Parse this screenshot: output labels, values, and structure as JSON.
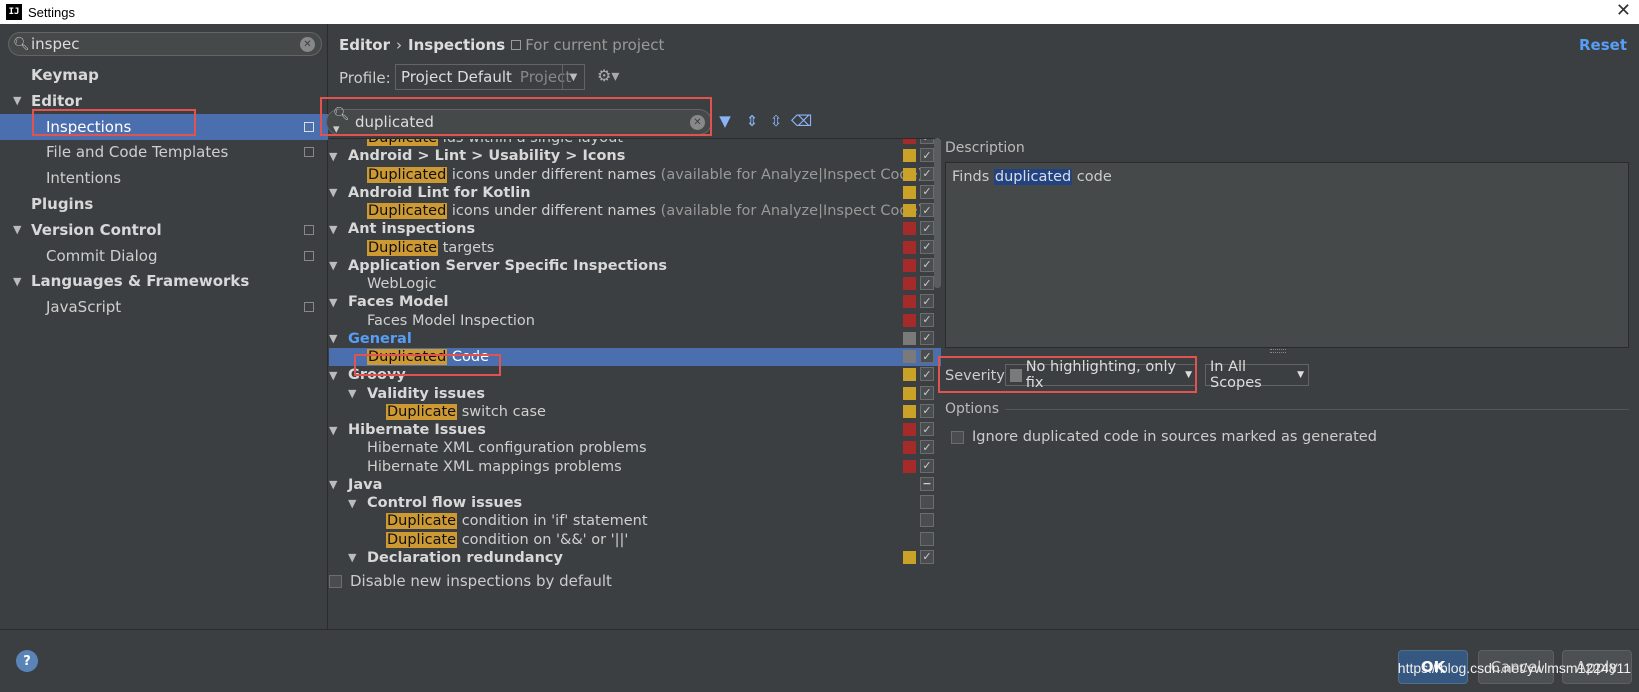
{
  "window": {
    "title": "Settings",
    "app_icon": "IJ"
  },
  "sidebar": {
    "search_value": "inspec",
    "items": [
      {
        "label": "Keymap",
        "bold": true,
        "arrow": "",
        "copy": false,
        "selected": false,
        "indent": 1
      },
      {
        "label": "Editor",
        "bold": true,
        "arrow": "▼",
        "copy": false,
        "selected": false,
        "indent": 1
      },
      {
        "label": "Inspections",
        "bold": false,
        "arrow": "",
        "copy": true,
        "selected": true,
        "indent": 2
      },
      {
        "label": "File and Code Templates",
        "bold": false,
        "arrow": "",
        "copy": true,
        "selected": false,
        "indent": 2
      },
      {
        "label": "Intentions",
        "bold": false,
        "arrow": "",
        "copy": false,
        "selected": false,
        "indent": 2
      },
      {
        "label": "Plugins",
        "bold": true,
        "arrow": "",
        "copy": false,
        "selected": false,
        "indent": 1
      },
      {
        "label": "Version Control",
        "bold": true,
        "arrow": "▼",
        "copy": true,
        "selected": false,
        "indent": 1
      },
      {
        "label": "Commit Dialog",
        "bold": false,
        "arrow": "",
        "copy": true,
        "selected": false,
        "indent": 2
      },
      {
        "label": "Languages & Frameworks",
        "bold": true,
        "arrow": "▼",
        "copy": false,
        "selected": false,
        "indent": 1
      },
      {
        "label": "JavaScript",
        "bold": false,
        "arrow": "",
        "copy": true,
        "selected": false,
        "indent": 2
      }
    ]
  },
  "header": {
    "crumb_1": "Editor",
    "crumb_sep": "›",
    "crumb_2": "Inspections",
    "scope_note": "For current project",
    "reset_label": "Reset"
  },
  "profile": {
    "label": "Profile:",
    "value": "Project Default",
    "type": "Project"
  },
  "inspection_search": {
    "value": "duplicated"
  },
  "colors": {
    "error": "#a52a2a",
    "warning": "#c9a227",
    "none": "#7a7a7a",
    "highlight": "#cc9933",
    "selection": "#4b6eaf",
    "link": "#589df6"
  },
  "inspections": [
    {
      "level": 2,
      "arrow": "",
      "hl": "Duplicate",
      "rest": " ids within a single layout",
      "dim": "",
      "bold": false,
      "sev": "error",
      "check": "✓"
    },
    {
      "level": 1,
      "arrow": "▼",
      "hl": "",
      "rest": "Android > Lint > Usability > Icons",
      "dim": "",
      "bold": true,
      "sev": "warning",
      "check": "✓"
    },
    {
      "level": 2,
      "arrow": "",
      "hl": "Duplicated",
      "rest": " icons under different names",
      "dim": " (available for Analyze|Inspect Code)",
      "bold": false,
      "sev": "warning",
      "check": "✓"
    },
    {
      "level": 1,
      "arrow": "▼",
      "hl": "",
      "rest": "Android Lint for Kotlin",
      "dim": "",
      "bold": true,
      "sev": "warning",
      "check": "✓"
    },
    {
      "level": 2,
      "arrow": "",
      "hl": "Duplicated",
      "rest": " icons under different names",
      "dim": " (available for Analyze|Inspect Code)",
      "bold": false,
      "sev": "warning",
      "check": "✓"
    },
    {
      "level": 1,
      "arrow": "▼",
      "hl": "",
      "rest": "Ant inspections",
      "dim": "",
      "bold": true,
      "sev": "error",
      "check": "✓"
    },
    {
      "level": 2,
      "arrow": "",
      "hl": "Duplicate",
      "rest": " targets",
      "dim": "",
      "bold": false,
      "sev": "error",
      "check": "✓"
    },
    {
      "level": 1,
      "arrow": "▼",
      "hl": "",
      "rest": "Application Server Specific Inspections",
      "dim": "",
      "bold": true,
      "sev": "error",
      "check": "✓"
    },
    {
      "level": 2,
      "arrow": "",
      "hl": "",
      "rest": "WebLogic",
      "dim": "",
      "bold": false,
      "sev": "error",
      "check": "✓"
    },
    {
      "level": 1,
      "arrow": "▼",
      "hl": "",
      "rest": "Faces Model",
      "dim": "",
      "bold": true,
      "sev": "error",
      "check": "✓"
    },
    {
      "level": 2,
      "arrow": "",
      "hl": "",
      "rest": "Faces Model Inspection",
      "dim": "",
      "bold": false,
      "sev": "error",
      "check": "✓"
    },
    {
      "level": 1,
      "arrow": "▼",
      "hl": "",
      "rest": "General",
      "dim": "",
      "bold": true,
      "link": true,
      "sev": "none",
      "check": "✓"
    },
    {
      "level": 2,
      "arrow": "",
      "hl": "Duplicated",
      "rest": " Code",
      "dim": "",
      "bold": false,
      "selected": true,
      "sev": "none",
      "check": "✓"
    },
    {
      "level": 1,
      "arrow": "▼",
      "hl": "",
      "rest": "Groovy",
      "dim": "",
      "bold": true,
      "sev": "warning",
      "check": "✓"
    },
    {
      "level": 2,
      "arrow": "▼",
      "hl": "",
      "rest": "Validity issues",
      "dim": "",
      "bold": true,
      "sev": "warning",
      "check": "✓"
    },
    {
      "level": 3,
      "arrow": "",
      "hl": "Duplicate",
      "rest": " switch case",
      "dim": "",
      "bold": false,
      "sev": "warning",
      "check": "✓"
    },
    {
      "level": 1,
      "arrow": "▼",
      "hl": "",
      "rest": "Hibernate Issues",
      "dim": "",
      "bold": true,
      "sev": "error",
      "check": "✓"
    },
    {
      "level": 2,
      "arrow": "",
      "hl": "",
      "rest": "Hibernate XML configuration problems",
      "dim": "",
      "bold": false,
      "sev": "error",
      "check": "✓"
    },
    {
      "level": 2,
      "arrow": "",
      "hl": "",
      "rest": "Hibernate XML mappings problems",
      "dim": "",
      "bold": false,
      "sev": "error",
      "check": "✓"
    },
    {
      "level": 1,
      "arrow": "▼",
      "hl": "",
      "rest": "Java",
      "dim": "",
      "bold": true,
      "sev": "",
      "check": "−"
    },
    {
      "level": 2,
      "arrow": "▼",
      "hl": "",
      "rest": "Control flow issues",
      "dim": "",
      "bold": true,
      "sev": "",
      "check": ""
    },
    {
      "level": 3,
      "arrow": "",
      "hl": "Duplicate",
      "rest": " condition in 'if' statement",
      "dim": "",
      "bold": false,
      "sev": "",
      "check": ""
    },
    {
      "level": 3,
      "arrow": "",
      "hl": "Duplicate",
      "rest": " condition on '&&' or '||'",
      "dim": "",
      "bold": false,
      "sev": "",
      "check": ""
    },
    {
      "level": 2,
      "arrow": "▼",
      "hl": "",
      "rest": "Declaration redundancy",
      "dim": "",
      "bold": true,
      "sev": "warning",
      "check": "✓"
    }
  ],
  "disable_new": {
    "label": "Disable new inspections by default"
  },
  "description": {
    "label": "Description",
    "prefix": "Finds ",
    "highlight": "duplicated",
    "suffix": " code"
  },
  "severity": {
    "label": "Severity:",
    "value": "No highlighting, only fix",
    "scope": "In All Scopes"
  },
  "options": {
    "label": "Options",
    "item": "Ignore duplicated code in sources marked as generated"
  },
  "footer": {
    "ok": "OK",
    "cancel": "Cancel",
    "apply": "Apply",
    "help": "?",
    "watermark": "https://blog.csdn.net/ywlmsm1224811"
  }
}
